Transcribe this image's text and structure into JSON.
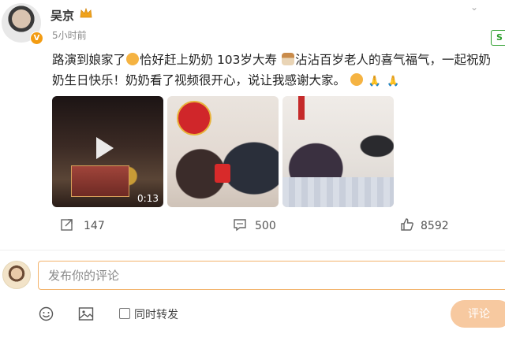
{
  "post": {
    "username": "吴京",
    "timestamp": "5小时前",
    "text_segments": [
      "路演到娘家了",
      "恰好赶上奶奶 103岁大寿",
      "沾沾百岁老人的喜气福气，一起祝奶奶生日快乐！奶奶看了视频很开心，说让我感谢大家。"
    ],
    "video_duration": "0:13",
    "brand_color": "#f39c12"
  },
  "actions": {
    "repost_count": "147",
    "comment_count": "500",
    "like_count": "8592"
  },
  "comment_box": {
    "placeholder": "发布你的评论",
    "checkbox_label": "同时转发",
    "submit_label": "评论"
  },
  "icons": {
    "repost": "share-arrow-icon",
    "comment": "comment-bubble-icon",
    "like": "thumbs-up-icon",
    "emoji": "smiley-icon",
    "image": "picture-icon"
  }
}
